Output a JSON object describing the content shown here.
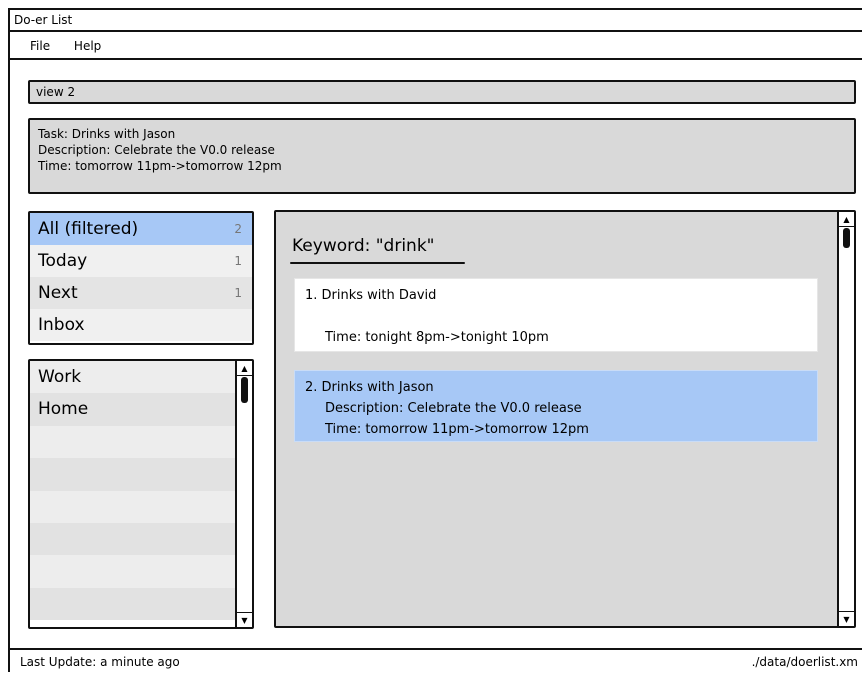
{
  "window": {
    "title": "Do-er List"
  },
  "menu": {
    "items": [
      "File",
      "Help"
    ]
  },
  "command": {
    "value": "view 2"
  },
  "result": {
    "lines": [
      "Task: Drinks with Jason",
      "Description: Celebrate the V0.0 release",
      "Time: tomorrow 11pm->tomorrow 12pm"
    ]
  },
  "categories": [
    {
      "label": "All (filtered)",
      "count": "2",
      "selected": true
    },
    {
      "label": "Today",
      "count": "1"
    },
    {
      "label": "Next",
      "count": "1"
    },
    {
      "label": "Inbox",
      "count": ""
    }
  ],
  "tags": [
    "Work",
    "Home",
    "",
    "",
    "",
    "",
    "",
    ""
  ],
  "tasks": {
    "heading": "Keyword: \"drink\"",
    "items": [
      {
        "title": "1. Drinks with David",
        "description": "",
        "time": "Time: tonight 8pm->tonight 10pm",
        "selected": false
      },
      {
        "title": "2. Drinks with Jason",
        "description": "Description: Celebrate the V0.0 release",
        "time": "Time: tomorrow 11pm->tomorrow 12pm",
        "selected": true
      }
    ]
  },
  "status": {
    "last_update": "Last Update: a minute ago",
    "file_path": "./data/doerlist.xm"
  },
  "colors": {
    "selected": "#a7c8f6",
    "panel_bg": "#d9d9d9",
    "border": "#111111"
  }
}
